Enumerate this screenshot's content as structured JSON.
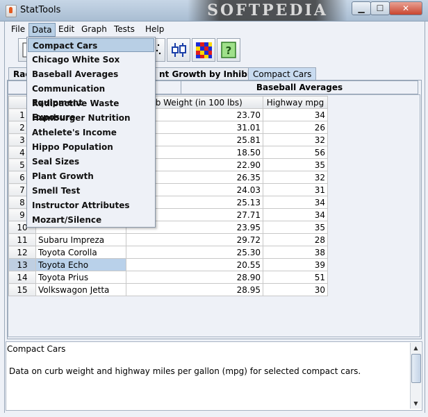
{
  "window": {
    "title": "StatTools",
    "watermark": "SOFTPEDIA",
    "controls": {
      "minimize": "▁",
      "maximize": "☐",
      "close": "✕"
    }
  },
  "menubar": [
    {
      "label": "File"
    },
    {
      "label": "Data"
    },
    {
      "label": "Edit"
    },
    {
      "label": "Graph"
    },
    {
      "label": "Tests"
    },
    {
      "label": "Help"
    }
  ],
  "toolbar": {
    "icons": [
      "table-icon",
      "scatter-plot-icon",
      "boxplot-icon",
      "color-grid-icon",
      "help-icon"
    ],
    "help_glyph": "?"
  },
  "tabs": [
    {
      "label": "Rac"
    },
    {
      "label": "nt Growth by Inhibitor"
    },
    {
      "label": "Compact Cars"
    }
  ],
  "subtabs": [
    {
      "label": ""
    },
    {
      "label": "Baseball Averages"
    }
  ],
  "table": {
    "headers": [
      "",
      "",
      "urb Weight (in 100 lbs)",
      "Highway mpg"
    ],
    "rows": [
      {
        "n": "1",
        "name": "",
        "weight": "23.70",
        "mpg": "34"
      },
      {
        "n": "2",
        "name": "",
        "weight": "31.01",
        "mpg": "26"
      },
      {
        "n": "3",
        "name": "",
        "weight": "25.81",
        "mpg": "32"
      },
      {
        "n": "4",
        "name": "",
        "weight": "18.50",
        "mpg": "56"
      },
      {
        "n": "5",
        "name": "",
        "weight": "22.90",
        "mpg": "35"
      },
      {
        "n": "6",
        "name": "",
        "weight": "26.35",
        "mpg": "32"
      },
      {
        "n": "7",
        "name": "",
        "weight": "24.03",
        "mpg": "31"
      },
      {
        "n": "8",
        "name": "",
        "weight": "25.13",
        "mpg": "34"
      },
      {
        "n": "9",
        "name": "",
        "weight": "27.71",
        "mpg": "34"
      },
      {
        "n": "10",
        "name": "",
        "weight": "23.95",
        "mpg": "35"
      },
      {
        "n": "11",
        "name": "Subaru Impreza",
        "weight": "29.72",
        "mpg": "28"
      },
      {
        "n": "12",
        "name": "Toyota Corolla",
        "weight": "25.30",
        "mpg": "38"
      },
      {
        "n": "13",
        "name": "Toyota Echo",
        "weight": "20.55",
        "mpg": "39"
      },
      {
        "n": "14",
        "name": "Toyota Prius",
        "weight": "28.90",
        "mpg": "51"
      },
      {
        "n": "15",
        "name": "Volkswagon Jetta",
        "weight": "28.95",
        "mpg": "30"
      }
    ],
    "selected_row": "13"
  },
  "description": {
    "title": "Compact Cars",
    "body": "Data on curb weight and highway miles per gallon (mpg) for selected compact cars."
  },
  "data_menu": {
    "items": [
      "Compact Cars",
      "Chicago White Sox",
      "Baseball Averages",
      "Communication Equipment",
      "Radioactive Waste Exposure",
      "Hamburger Nutrition",
      "Athelete's Income",
      "Hippo Population",
      "Seal Sizes",
      "Plant Growth",
      "Smell Test",
      "Instructor Attributes",
      "Mozart/Silence"
    ],
    "highlighted": "Compact Cars"
  },
  "colors": {
    "highlight": "#b8cfe5",
    "selected_cell": "#b9d1ea",
    "close_button": "#c9452f"
  }
}
